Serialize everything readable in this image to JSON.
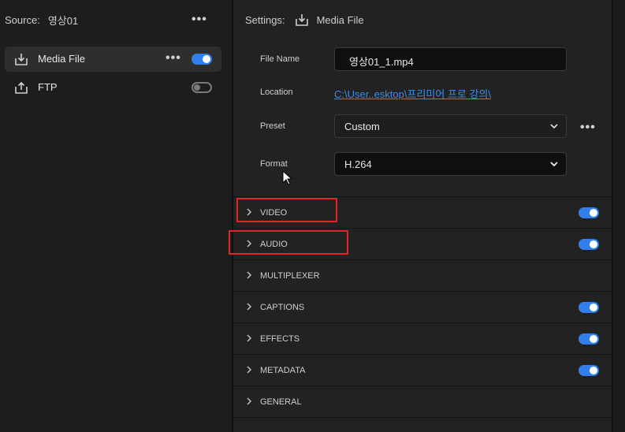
{
  "source": {
    "label": "Source:",
    "name": "영상01"
  },
  "destinations": [
    {
      "label": "Media File",
      "icon": "download-icon",
      "enabled": true
    },
    {
      "label": "FTP",
      "icon": "upload-icon",
      "enabled": false
    }
  ],
  "settings": {
    "label": "Settings:",
    "icon": "download-icon",
    "destination_name": "Media File",
    "file_name": {
      "label": "File Name",
      "value": "영상01_1.mp4"
    },
    "location": {
      "label": "Location",
      "value": "C:\\User..esktop\\프리미어 프로 강의\\"
    },
    "preset": {
      "label": "Preset",
      "value": "Custom"
    },
    "format": {
      "label": "Format",
      "value": "H.264"
    }
  },
  "sections": [
    {
      "label": "VIDEO",
      "enabled": true
    },
    {
      "label": "AUDIO",
      "enabled": true
    },
    {
      "label": "MULTIPLEXER",
      "enabled": null
    },
    {
      "label": "CAPTIONS",
      "enabled": true
    },
    {
      "label": "EFFECTS",
      "enabled": true
    },
    {
      "label": "METADATA",
      "enabled": true
    },
    {
      "label": "GENERAL",
      "enabled": null
    }
  ],
  "colors": {
    "accent": "#2f80ed",
    "highlight": "#e0262b",
    "link": "#3d8ee8"
  }
}
